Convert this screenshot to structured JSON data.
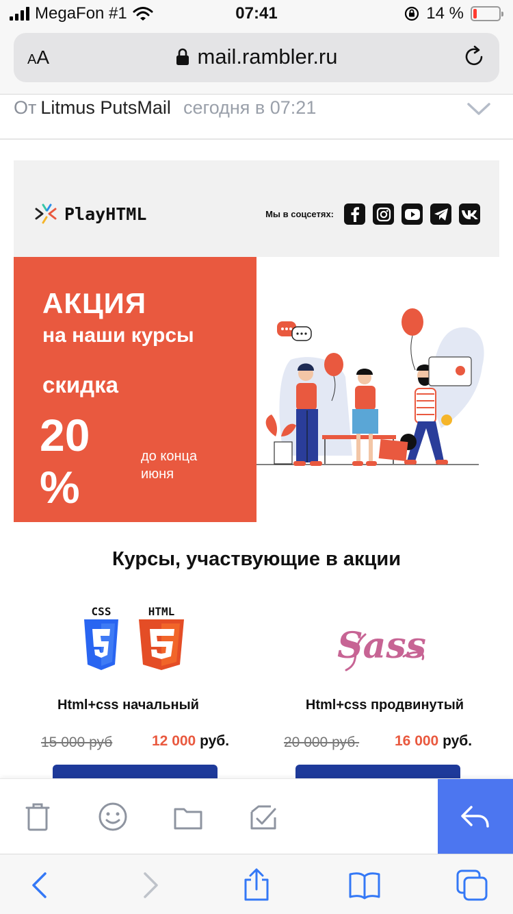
{
  "status_bar": {
    "carrier": "MegaFon #1",
    "time": "07:41",
    "battery": "14 %",
    "battery_level": 0.14
  },
  "browser": {
    "text_size_label": "AA",
    "url": "mail.rambler.ru"
  },
  "message": {
    "from_label": "От",
    "sender": "Litmus PutsMail",
    "date": "сегодня в 07:21"
  },
  "email": {
    "brand": "PlayHTML",
    "social_label": "Мы в соцсетях:",
    "socials": [
      "facebook-icon",
      "instagram-icon",
      "youtube-icon",
      "telegram-icon",
      "vk-icon"
    ],
    "hero": {
      "title": "АКЦИЯ",
      "subtitle": "на наши курсы",
      "discount_label": "скидка",
      "discount_value": "20",
      "discount_unit": "%",
      "note_line1": "до конца",
      "note_line2": "июня"
    },
    "courses_title": "Курсы, участвующие в акции",
    "courses": [
      {
        "name": "Html+css начальный",
        "old_price": "15 000 руб",
        "new_price": "12 000",
        "currency": "руб.",
        "icon_1_label": "CSS",
        "icon_2_label": "HTML"
      },
      {
        "name": "Html+css продвинутый",
        "old_price": "20 000 руб.",
        "new_price": "16 000",
        "currency": "руб.",
        "icon_label": "Sass"
      }
    ],
    "colors": {
      "accent": "#e9593f",
      "button": "#1e3a9a"
    }
  },
  "mail_toolbar": {
    "icons": [
      "trash-icon",
      "emoji-icon",
      "folder-icon",
      "checkbox-icon",
      "reply-icon"
    ],
    "reply_color": "#4c76f0"
  },
  "safari_toolbar": {
    "icons": [
      "back-icon",
      "forward-icon",
      "share-icon",
      "bookmarks-icon",
      "tabs-icon"
    ]
  }
}
